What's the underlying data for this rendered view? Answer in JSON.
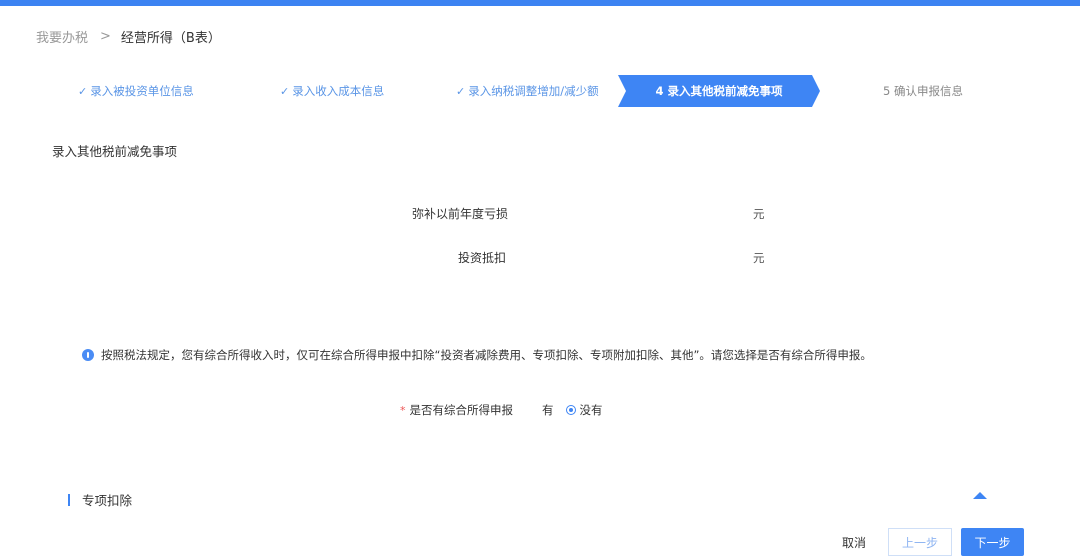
{
  "breadcrumb": {
    "home": "我要办税",
    "separator": ">",
    "current": "经营所得（B表）"
  },
  "steps": [
    {
      "label": "录入被投资单位信息",
      "status": "done"
    },
    {
      "label": "录入收入成本信息",
      "status": "done"
    },
    {
      "label": "录入纳税调整增加/减少额",
      "status": "done"
    },
    {
      "label": "4 录入其他税前减免事项",
      "status": "active"
    },
    {
      "label": "5 确认申报信息",
      "status": "todo"
    }
  ],
  "section_title": "录入其他税前减免事项",
  "fields": [
    {
      "label": "弥补以前年度亏损",
      "unit": "元"
    },
    {
      "label": "投资抵扣",
      "unit": "元"
    }
  ],
  "notice": "按照税法规定，您有综合所得收入时，仅可在综合所得申报中扣除“投资者减除费用、专项扣除、专项附加扣除、其他”。请您选择是否有综合所得申报。",
  "comprehensive_income": {
    "required_mark": "*",
    "label": "是否有综合所得申报",
    "options": [
      "有",
      "没有"
    ],
    "selected": "没有"
  },
  "special_deduction": {
    "title": "专项扣除"
  },
  "footer": {
    "cancel": "取消",
    "prev": "上一步",
    "next": "下一步"
  },
  "colors": {
    "accent": "#3e85f4",
    "done_step": "#5a95e6"
  }
}
